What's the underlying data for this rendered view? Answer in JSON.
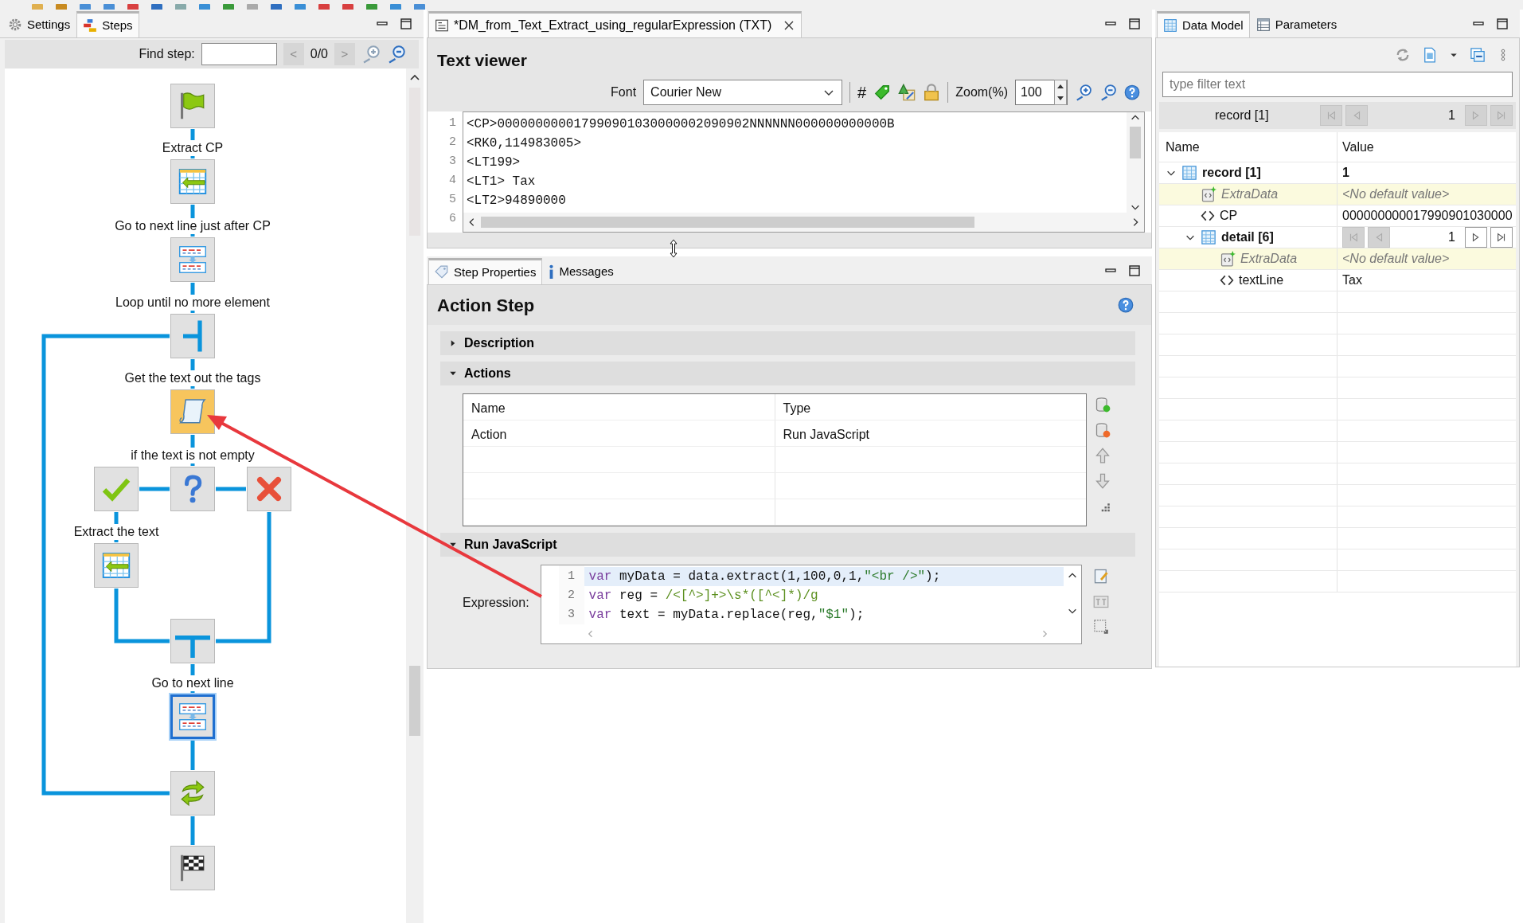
{
  "left_panel": {
    "tabs": [
      {
        "label": "Settings",
        "selected": false,
        "kind": "settings"
      },
      {
        "label": "Steps",
        "selected": true,
        "kind": "steps"
      }
    ],
    "find_step": {
      "label": "Find step:",
      "prev": "<",
      "counter": "0/0",
      "next": ">"
    }
  },
  "steps": [
    {
      "kind": "start",
      "selected": false,
      "focused": false
    },
    {
      "kind": "extract",
      "label": "Extract CP",
      "selected": false,
      "focused": false
    },
    {
      "kind": "next_line",
      "label": "Go to next line just after CP",
      "selected": false,
      "focused": false
    },
    {
      "kind": "loop_start",
      "label": "Loop until no more element",
      "selected": false,
      "focused": false
    },
    {
      "kind": "script",
      "label": "Get the text out the tags",
      "selected": true,
      "focused": false
    },
    {
      "kind": "condition",
      "label": "if the text is not empty",
      "selected": false,
      "focused": false
    },
    {
      "kind": "branch_true",
      "selected": false,
      "focused": false
    },
    {
      "kind": "branch_false",
      "selected": false,
      "focused": false
    },
    {
      "kind": "extract",
      "label": "Extract the text",
      "selected": false,
      "focused": false
    },
    {
      "kind": "join",
      "selected": false,
      "focused": false
    },
    {
      "kind": "next_line",
      "label": "Go to next line",
      "selected": false,
      "focused": true
    },
    {
      "kind": "loop_end",
      "selected": false,
      "focused": false
    },
    {
      "kind": "end",
      "selected": false,
      "focused": false
    }
  ],
  "editor": {
    "tab": {
      "title": "*DM_from_Text_Extract_using_regularExpression (TXT)"
    },
    "viewer": {
      "title": "Text viewer",
      "font_label": "Font",
      "font": "Courier New",
      "hash": "#",
      "zoom_label": "Zoom(%)",
      "zoom": "100",
      "lines": [
        {
          "number": "1",
          "text": "<CP>000000000017990901030000002090902NNNNNN000000000000B"
        },
        {
          "number": "2",
          "text": "<RK0,114983005>"
        },
        {
          "number": "3",
          "text": "<LT199>"
        },
        {
          "number": "4",
          "text": "<LT1> Tax"
        },
        {
          "number": "5",
          "text": "<LT2>94890000"
        },
        {
          "number": "6"
        }
      ]
    }
  },
  "step_properties": {
    "tabs": [
      {
        "label": "Step Properties",
        "selected": true,
        "kind": "properties"
      },
      {
        "label": "Messages",
        "selected": false,
        "kind": "messages"
      }
    ],
    "title": "Action Step",
    "sections": [
      {
        "kind": "description",
        "title": "Description",
        "expanded": false
      },
      {
        "kind": "actions",
        "title": "Actions",
        "expanded": true
      },
      {
        "kind": "script",
        "title": "Run JavaScript",
        "expanded": true
      }
    ],
    "actions_table": {
      "columns": [
        "Name",
        "Type"
      ],
      "rows": [
        [
          "Action",
          "Run JavaScript"
        ]
      ]
    },
    "expression": {
      "label": "Expression:",
      "lines": [
        {
          "number": "1",
          "current": true,
          "tokens": [
            {
              "kind": "keyword",
              "text": "var"
            },
            {
              "kind": "plain",
              "text": " myData = data.extract(1,100,0,1,"
            },
            {
              "kind": "string",
              "text": "\"<br />\""
            },
            {
              "kind": "plain",
              "text": ");"
            }
          ]
        },
        {
          "number": "2",
          "current": false,
          "tokens": [
            {
              "kind": "keyword",
              "text": "var"
            },
            {
              "kind": "plain",
              "text": " reg = "
            },
            {
              "kind": "regex",
              "text": "/<[^>]+>\\s*([^<]*)/g"
            }
          ]
        },
        {
          "number": "3",
          "current": false,
          "tokens": [
            {
              "kind": "keyword",
              "text": "var"
            },
            {
              "kind": "plain",
              "text": " text = myData.replace(reg,"
            },
            {
              "kind": "string",
              "text": "\"$1\""
            },
            {
              "kind": "plain",
              "text": ");"
            }
          ]
        }
      ]
    }
  },
  "data_model": {
    "tabs": [
      {
        "label": "Data Model",
        "selected": true
      },
      {
        "label": "Parameters",
        "selected": false
      }
    ],
    "filter_placeholder": "type filter text",
    "record_nav": {
      "label": "record [1]",
      "counter": "1"
    },
    "columns": [
      "Name",
      "Value"
    ],
    "tree": [
      {
        "kind": "group",
        "name": "record [1]",
        "value": "1",
        "expanded": true,
        "children": [
          {
            "kind": "extra",
            "name": "ExtraData",
            "value": "<No default value>"
          },
          {
            "kind": "field",
            "name": "CP",
            "value": "000000000017990901030000"
          },
          {
            "kind": "group",
            "name": "detail [6]",
            "counter": "1",
            "expanded": true,
            "children": [
              {
                "kind": "extra",
                "name": "ExtraData",
                "value": "<No default value>"
              },
              {
                "kind": "field",
                "name": "textLine",
                "value": "Tax"
              }
            ]
          }
        ]
      }
    ]
  }
}
